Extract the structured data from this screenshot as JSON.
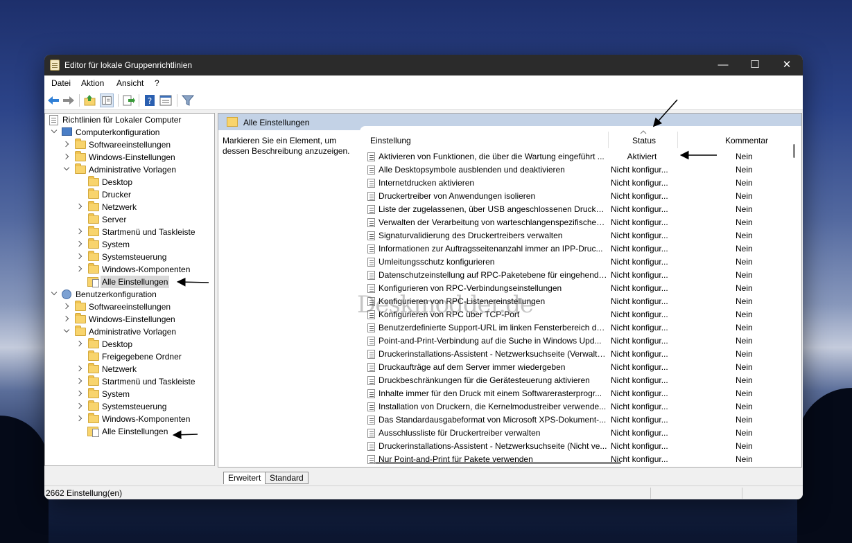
{
  "window": {
    "title": "Editor für lokale Gruppenrichtlinien",
    "controls": {
      "minimize": "—",
      "maximize": "☐",
      "close": "✕"
    }
  },
  "menu": {
    "file": "Datei",
    "action": "Aktion",
    "view": "Ansicht",
    "help": "?"
  },
  "tree": {
    "root": "Richtlinien für Lokaler Computer",
    "computer": "Computerkonfiguration",
    "c_software": "Softwareeinstellungen",
    "c_windows": "Windows-Einstellungen",
    "c_admin": "Administrative Vorlagen",
    "c_desktop": "Desktop",
    "c_drucker": "Drucker",
    "c_netzwerk": "Netzwerk",
    "c_server": "Server",
    "c_startmenu": "Startmenü und Taskleiste",
    "c_system": "System",
    "c_systemsteuerung": "Systemsteuerung",
    "c_windows_komp": "Windows-Komponenten",
    "c_alle": "Alle Einstellungen",
    "user": "Benutzerkonfiguration",
    "u_software": "Softwareeinstellungen",
    "u_windows": "Windows-Einstellungen",
    "u_admin": "Administrative Vorlagen",
    "u_desktop": "Desktop",
    "u_freigegeben": "Freigegebene Ordner",
    "u_netzwerk": "Netzwerk",
    "u_startmenu": "Startmenü und Taskleiste",
    "u_system": "System",
    "u_systemsteuerung": "Systemsteuerung",
    "u_windows_komp": "Windows-Komponenten",
    "u_alle": "Alle Einstellungen"
  },
  "panel": {
    "header": "Alle Einstellungen",
    "description": "Markieren Sie ein Element, um dessen Beschreibung anzuzeigen."
  },
  "columns": {
    "setting": "Einstellung",
    "status": "Status",
    "comment": "Kommentar"
  },
  "rows": [
    {
      "name": "Aktivieren von Funktionen, die über die Wartung eingeführt ...",
      "status": "Aktiviert",
      "comment": "Nein"
    },
    {
      "name": "Alle Desktopsymbole ausblenden und deaktivieren",
      "status": "Nicht konfigur...",
      "comment": "Nein"
    },
    {
      "name": "Internetdrucken aktivieren",
      "status": "Nicht konfigur...",
      "comment": "Nein"
    },
    {
      "name": "Druckertreiber von Anwendungen isolieren",
      "status": "Nicht konfigur...",
      "comment": "Nein"
    },
    {
      "name": "Liste der zugelassenen, über USB angeschlossenen Druckerg...",
      "status": "Nicht konfigur...",
      "comment": "Nein"
    },
    {
      "name": "Verwalten der Verarbeitung von warteschlangenspezifischen ...",
      "status": "Nicht konfigur...",
      "comment": "Nein"
    },
    {
      "name": "Signaturvalidierung des Druckertreibers verwalten",
      "status": "Nicht konfigur...",
      "comment": "Nein"
    },
    {
      "name": "Informationen zur Auftragsseitenanzahl immer an IPP-Druc...",
      "status": "Nicht konfigur...",
      "comment": "Nein"
    },
    {
      "name": "Umleitungsschutz konfigurieren",
      "status": "Nicht konfigur...",
      "comment": "Nein"
    },
    {
      "name": "Datenschutzeinstellung auf RPC-Paketebene für eingehende...",
      "status": "Nicht konfigur...",
      "comment": "Nein"
    },
    {
      "name": "Konfigurieren von RPC-Verbindungseinstellungen",
      "status": "Nicht konfigur...",
      "comment": "Nein"
    },
    {
      "name": "Konfigurieren von RPC-Listenereinstellungen",
      "status": "Nicht konfigur...",
      "comment": "Nein"
    },
    {
      "name": "Konfigurieren von RPC über TCP-Port",
      "status": "Nicht konfigur...",
      "comment": "Nein"
    },
    {
      "name": "Benutzerdefinierte Support-URL im linken Fensterbereich de...",
      "status": "Nicht konfigur...",
      "comment": "Nein"
    },
    {
      "name": "Point-and-Print-Verbindung auf die Suche in Windows Upd...",
      "status": "Nicht konfigur...",
      "comment": "Nein"
    },
    {
      "name": "Druckerinstallations-Assistent - Netzwerksuchseite (Verwalte...",
      "status": "Nicht konfigur...",
      "comment": "Nein"
    },
    {
      "name": "Druckaufträge auf dem Server immer wiedergeben",
      "status": "Nicht konfigur...",
      "comment": "Nein"
    },
    {
      "name": "Druckbeschränkungen für die Gerätesteuerung aktivieren",
      "status": "Nicht konfigur...",
      "comment": "Nein"
    },
    {
      "name": "Inhalte immer für den Druck mit einem Softwarerasterprogr...",
      "status": "Nicht konfigur...",
      "comment": "Nein"
    },
    {
      "name": "Installation von Druckern, die Kernelmodustreiber verwende...",
      "status": "Nicht konfigur...",
      "comment": "Nein"
    },
    {
      "name": "Das Standardausgabeformat von Microsoft XPS-Dokument-...",
      "status": "Nicht konfigur...",
      "comment": "Nein"
    },
    {
      "name": "Ausschlussliste für Druckertreiber verwalten",
      "status": "Nicht konfigur...",
      "comment": "Nein"
    },
    {
      "name": "Druckerinstallations-Assistent - Netzwerksuchseite (Nicht ve...",
      "status": "Nicht konfigur...",
      "comment": "Nein"
    },
    {
      "name": "Nur Point-and-Print für Pakete verwenden",
      "status": "Nicht konfigur...",
      "comment": "Nein"
    }
  ],
  "tabs": {
    "extended": "Erweitert",
    "standard": "Standard"
  },
  "statusbar": {
    "text": "2662 Einstellung(en)"
  },
  "watermark": "Deskmodder.de"
}
